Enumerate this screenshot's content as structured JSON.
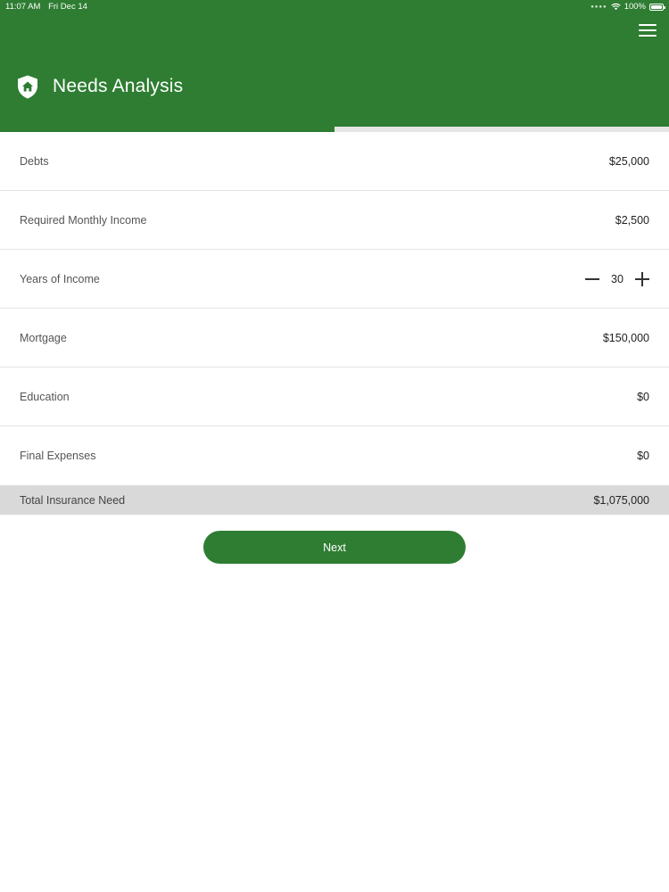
{
  "status_bar": {
    "time": "11:07 AM",
    "date": "Fri Dec 14",
    "battery": "100%",
    "icons": [
      "wifi-icon",
      "battery-icon"
    ]
  },
  "header": {
    "title": "Needs Analysis",
    "icon": "shield-home-icon",
    "menu_icon": "hamburger-menu-icon"
  },
  "progress": {
    "fraction": 0.5
  },
  "fields": [
    {
      "label": "Debts",
      "value": "$25,000"
    },
    {
      "label": "Required Monthly Income",
      "value": "$2,500"
    },
    {
      "label": "Years of Income",
      "value": "30"
    },
    {
      "label": "Mortgage",
      "value": "$150,000"
    },
    {
      "label": "Education",
      "value": "$0"
    },
    {
      "label": "Final Expenses",
      "value": "$0"
    }
  ],
  "total": {
    "label": "Total Insurance Need",
    "value": "$1,075,000"
  },
  "next_label": "Next",
  "colors": {
    "brand_green": "#2e7d32",
    "total_bg": "#d9d9d9",
    "divider": "#e3e3e3"
  }
}
